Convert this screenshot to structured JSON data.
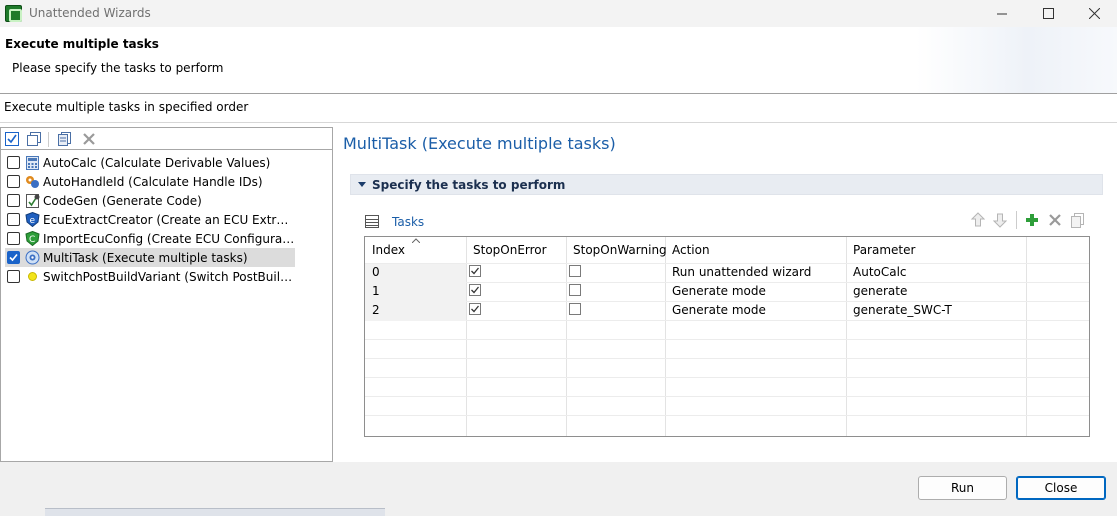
{
  "window": {
    "title": "Unattended Wizards"
  },
  "header": {
    "title": "Execute multiple tasks",
    "subtitle": "Please specify the tasks to perform",
    "description": "Execute multiple tasks in specified order"
  },
  "tree": {
    "items": [
      {
        "label": "AutoCalc (Calculate Derivable Values)",
        "checked": false,
        "icon": "calculator-icon"
      },
      {
        "label": "AutoHandleId (Calculate Handle IDs)",
        "checked": false,
        "icon": "handle-id-icon"
      },
      {
        "label": "CodeGen (Generate Code)",
        "checked": false,
        "icon": "codegen-icon"
      },
      {
        "label": "EcuExtractCreator (Create an ECU Extract)",
        "checked": false,
        "icon": "ecu-extract-icon"
      },
      {
        "label": "ImportEcuConfig (Create ECU Configuration)",
        "checked": false,
        "icon": "import-ecu-icon"
      },
      {
        "label": "MultiTask (Execute multiple tasks)",
        "checked": true,
        "selected": true,
        "icon": "multitask-icon"
      },
      {
        "label": "SwitchPostBuildVariant (Switch PostBuildVaria...",
        "checked": false,
        "icon": "variant-icon"
      }
    ]
  },
  "detail": {
    "title": "MultiTask (Execute multiple tasks)",
    "section_title": "Specify the tasks to perform",
    "tasks_label": "Tasks"
  },
  "table": {
    "columns": [
      "Index",
      "StopOnError",
      "StopOnWarning",
      "Action",
      "Parameter"
    ],
    "rows": [
      {
        "index": "0",
        "stop_on_error": true,
        "stop_on_warning": false,
        "action": "Run unattended wizard",
        "parameter": "AutoCalc"
      },
      {
        "index": "1",
        "stop_on_error": true,
        "stop_on_warning": false,
        "action": "Generate mode",
        "parameter": "generate"
      },
      {
        "index": "2",
        "stop_on_error": true,
        "stop_on_warning": false,
        "action": "Generate mode",
        "parameter": "generate_SWC-T"
      }
    ]
  },
  "footer": {
    "run_label": "Run",
    "close_label": "Close"
  },
  "colors": {
    "accent_blue": "#1b5ea8",
    "checkbox_blue": "#1a63c9",
    "add_green": "#2e9e3a"
  }
}
